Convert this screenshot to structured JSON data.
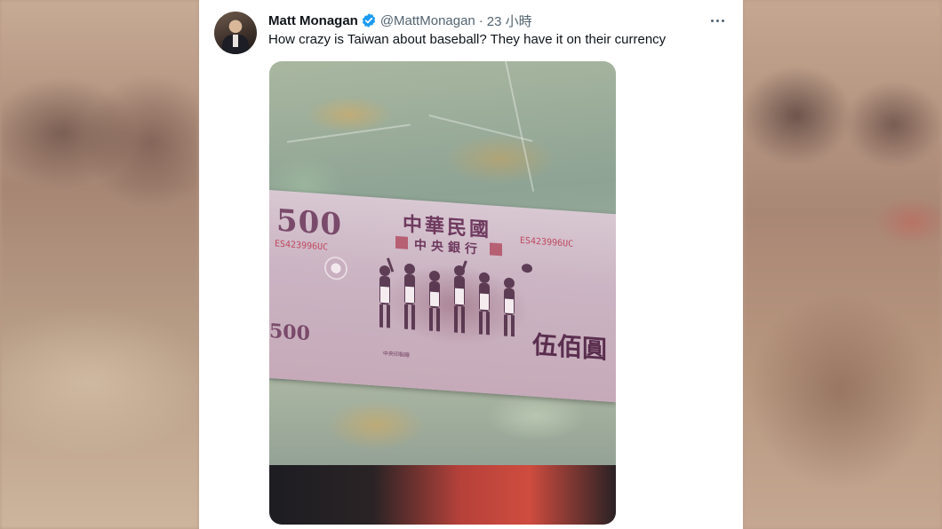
{
  "tweet": {
    "author_name": "Matt Monagan",
    "handle": "@MattMonagan",
    "separator": "·",
    "time": "23 小時",
    "text": "How crazy is Taiwan about baseball? They have it on their currency",
    "verified": true,
    "avatar_icon": "avatar",
    "more_icon": "more-options-icon"
  },
  "photo": {
    "banknote": {
      "denomination": "500",
      "title": "中華民國",
      "subtitle": "中央銀行",
      "serial": "ES423996UC",
      "serial_left": "ES423996UC",
      "value_chinese": "伍佰圓",
      "printer": "中央印製廠"
    }
  },
  "colors": {
    "text_primary": "#0f1419",
    "text_secondary": "#536471",
    "verified_blue": "#1d9bf0",
    "banknote": "#cbb4c3"
  }
}
